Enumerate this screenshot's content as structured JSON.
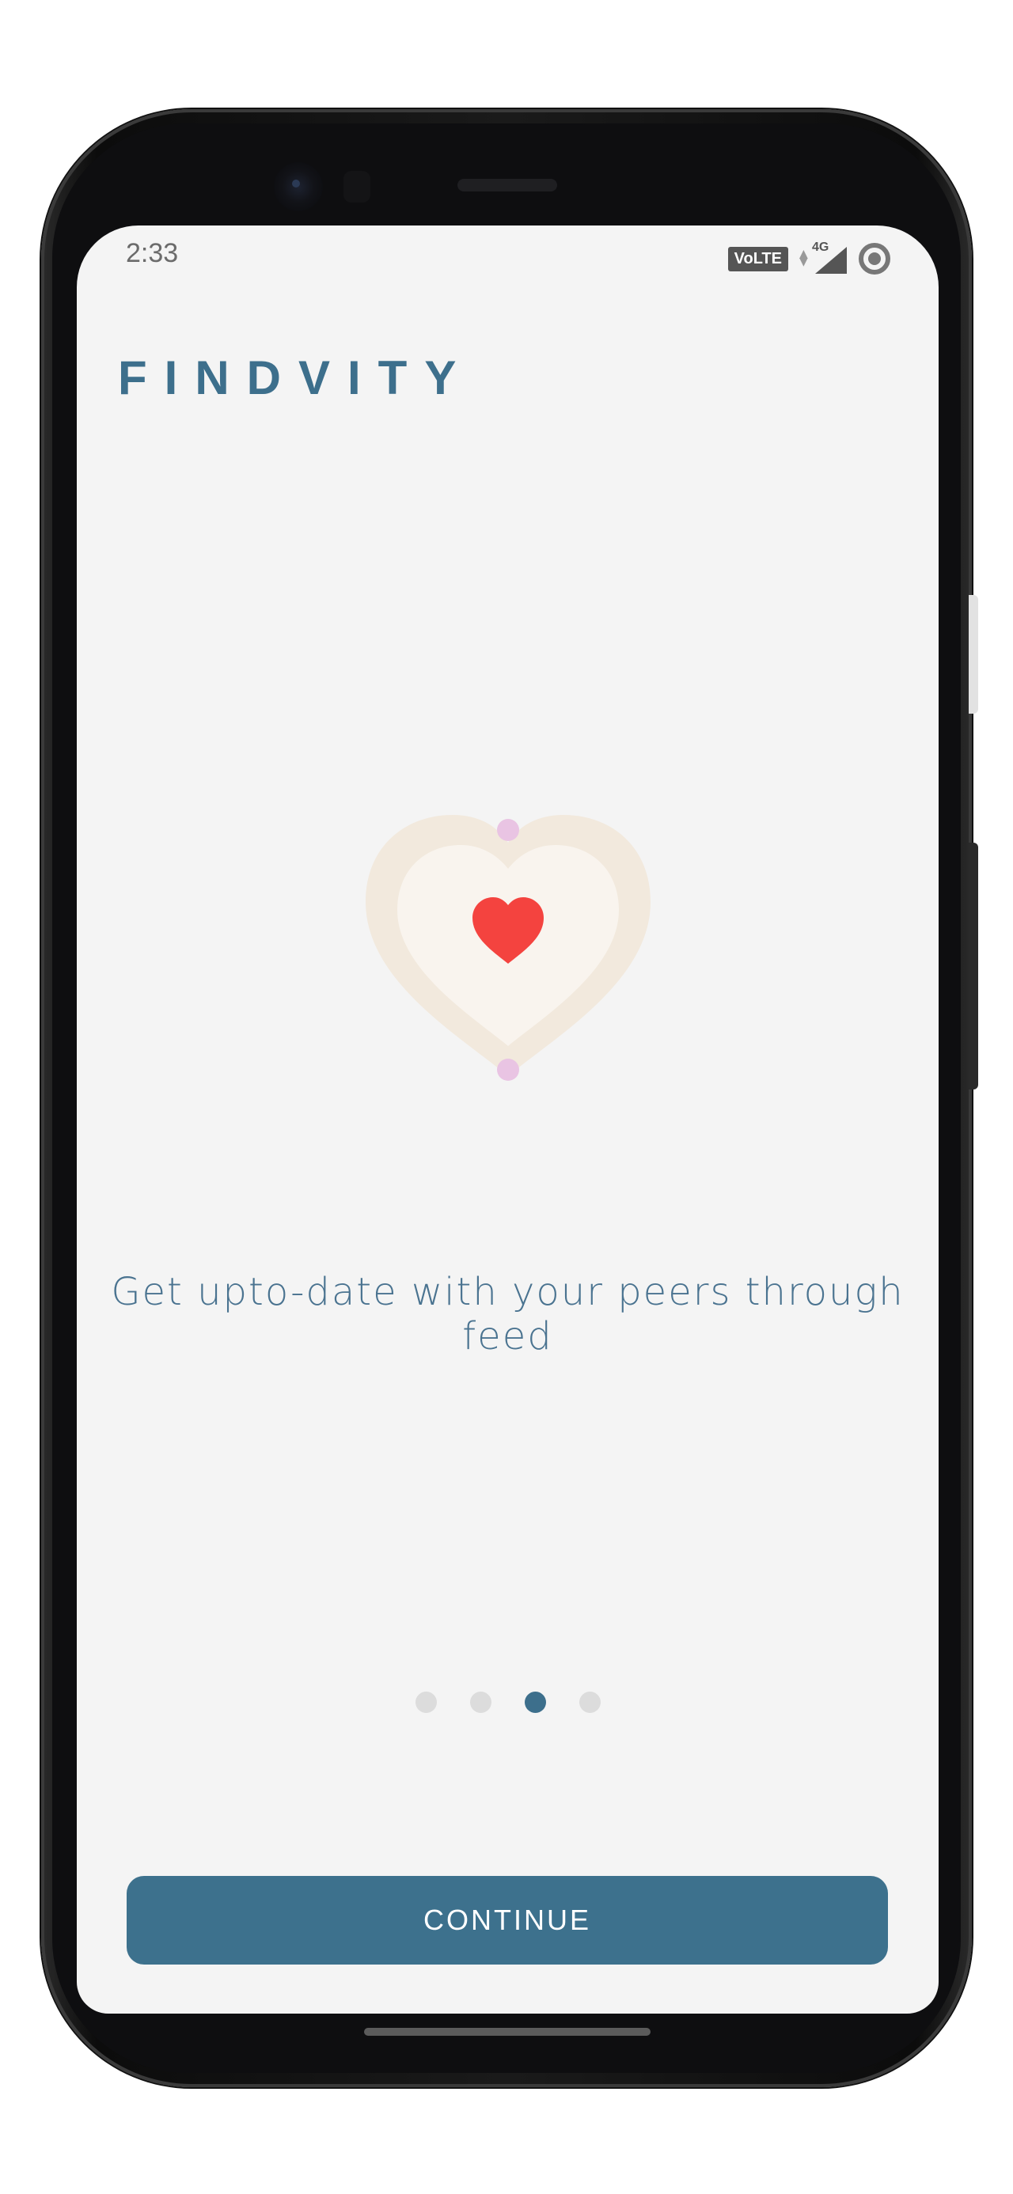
{
  "status_bar": {
    "time": "2:33",
    "volte_label": "VoLTE",
    "network_label": "4G"
  },
  "app": {
    "brand": "FINDVITY"
  },
  "onboarding": {
    "tagline": "Get upto-date with your peers through feed",
    "page_count": 4,
    "active_page_index": 2,
    "continue_label": "CONTINUE"
  },
  "colors": {
    "brand": "#3d6f8c",
    "button": "#3d718d",
    "heart": "#f4433f",
    "background": "#f4f4f4"
  },
  "icons": {
    "hero": "heart-icon",
    "signal": "signal-icon",
    "status_ring": "ring-icon"
  }
}
